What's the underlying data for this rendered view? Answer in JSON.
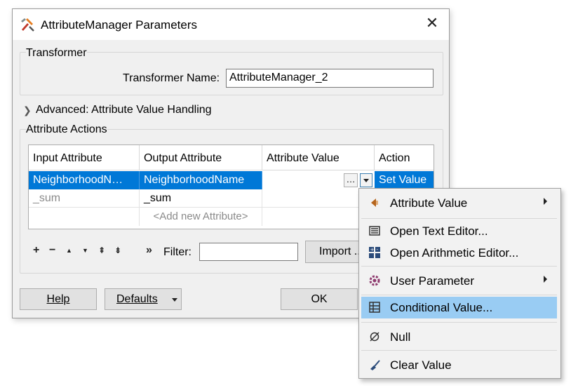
{
  "dialog": {
    "title": "AttributeManager Parameters",
    "transformer_group": "Transformer",
    "transformer_name_label": "Transformer Name:",
    "transformer_name_value": "AttributeManager_2",
    "advanced_label": "Advanced: Attribute Value Handling",
    "actions_group": "Attribute Actions"
  },
  "table": {
    "headers": [
      "Input Attribute",
      "Output Attribute",
      "Attribute Value",
      "Action"
    ],
    "rows": [
      {
        "input": "NeighborhoodN…",
        "output": "NeighborhoodName",
        "value": "",
        "action": "Set Value"
      },
      {
        "input": "_sum",
        "output": "_sum",
        "value": "",
        "action": ""
      },
      {
        "input": "",
        "output": "<Add new Attribute>",
        "value": "",
        "action": ""
      }
    ],
    "ellipsis_label": "…"
  },
  "toolbar": {
    "add": "+",
    "remove": "−",
    "up": "▲",
    "down": "▼",
    "top": "⇞",
    "bottom": "⇟",
    "more": "»",
    "filter_label": "Filter:",
    "filter_value": "",
    "import_label": "Import ..."
  },
  "buttons": {
    "help": "Help",
    "defaults": "Defaults",
    "ok": "OK"
  },
  "menu": {
    "items": [
      {
        "label": "Attribute Value",
        "icon": "attribute-value-icon",
        "submenu": true
      },
      {
        "label": "Open Text Editor...",
        "icon": "text-editor-icon",
        "submenu": false
      },
      {
        "label": "Open Arithmetic Editor...",
        "icon": "arithmetic-editor-icon",
        "submenu": false
      },
      {
        "label": "User Parameter",
        "icon": "user-parameter-icon",
        "submenu": true
      },
      {
        "label": "Conditional Value...",
        "icon": "conditional-value-icon",
        "submenu": false,
        "highlighted": true
      },
      {
        "label": "Null",
        "icon": "null-icon",
        "submenu": false
      },
      {
        "label": "Clear Value",
        "icon": "clear-value-icon",
        "submenu": false
      }
    ]
  },
  "colors": {
    "selection": "#0078d7",
    "menu_highlight": "#99ccf3",
    "dialog_bg": "#f0f0f0"
  }
}
